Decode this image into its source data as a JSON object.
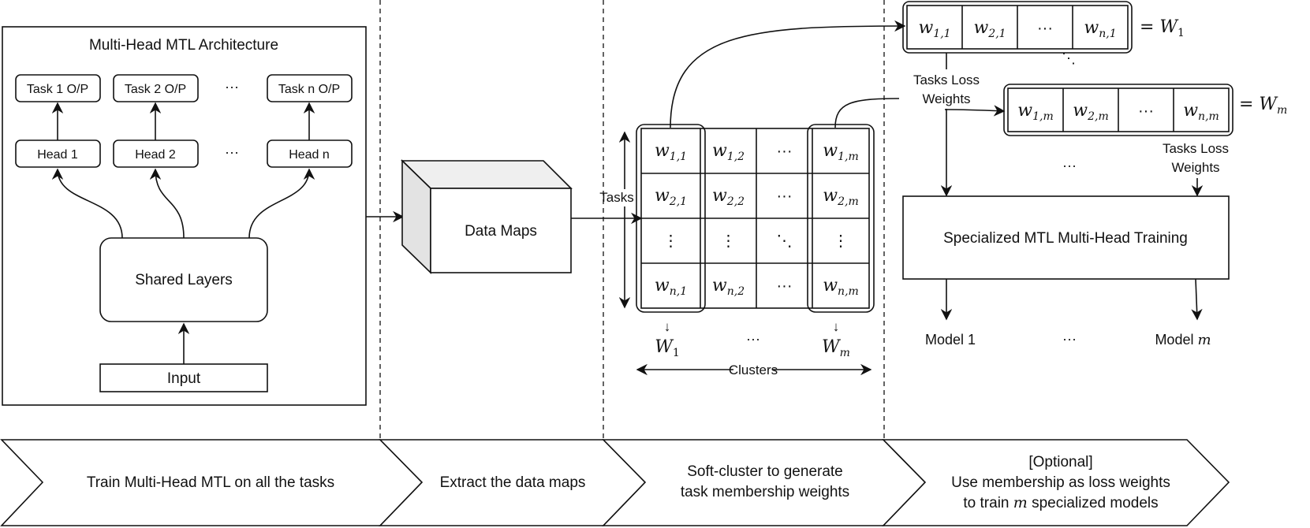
{
  "architecture": {
    "title": "Multi-Head MTL Architecture",
    "outputs": [
      "Task 1 O/P",
      "Task 2 O/P",
      "Task n O/P"
    ],
    "heads": [
      "Head 1",
      "Head 2",
      "Head n"
    ],
    "ellipsis": "···",
    "shared": "Shared Layers",
    "input": "Input"
  },
  "data_maps": {
    "label": "Data Maps"
  },
  "matrix": {
    "rows_label": "Tasks",
    "cols_label": "Clusters",
    "cells": [
      [
        "w1,1",
        "w1,2",
        "···",
        "w1,m"
      ],
      [
        "w2,1",
        "w2,2",
        "···",
        "w2,m"
      ],
      [
        "⋮",
        "⋮",
        "⋱",
        "⋮"
      ],
      [
        "wn,1",
        "wn,2",
        "···",
        "wn,m"
      ]
    ],
    "col_labels": [
      "↓",
      "···",
      "↓"
    ],
    "col_vectors": [
      "W1",
      "Wm"
    ]
  },
  "vectors": {
    "first": {
      "cells": [
        "w1,1",
        "w2,1",
        "···",
        "wn,1"
      ],
      "equals": "= W1"
    },
    "last": {
      "cells": [
        "w1,m",
        "w2,m",
        "···",
        "wn,m"
      ],
      "equals": "= Wm"
    },
    "diag_ellipsis": "⋱",
    "loss_label_line1": "Tasks Loss",
    "loss_label_line2": "Weights"
  },
  "training": {
    "box_label": "Specialized MTL Multi-Head Training",
    "mid_ellipsis": "···",
    "models": [
      "Model 1",
      "···",
      "Model m"
    ]
  },
  "steps": [
    {
      "lines": [
        "Train Multi-Head MTL on all the tasks"
      ]
    },
    {
      "lines": [
        "Extract the data maps"
      ]
    },
    {
      "lines": [
        "Soft-cluster to generate",
        "task membership weights"
      ]
    },
    {
      "lines": [
        "[Optional]",
        "Use membership as loss weights",
        "to train m specialized models"
      ]
    }
  ]
}
